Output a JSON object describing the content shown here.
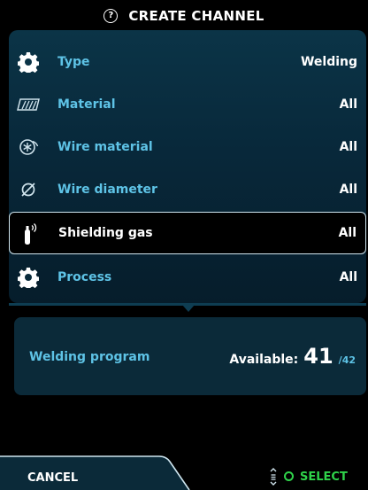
{
  "header": {
    "help_icon": "help-circle-icon",
    "help_glyph": "?",
    "title": "CREATE CHANNEL"
  },
  "list": {
    "items": [
      {
        "icon": "gear-icon",
        "label": "Type",
        "value": "Welding",
        "selected": false
      },
      {
        "icon": "material-icon",
        "label": "Material",
        "value": "All",
        "selected": false
      },
      {
        "icon": "wire-spool-icon",
        "label": "Wire material",
        "value": "All",
        "selected": false
      },
      {
        "icon": "diameter-icon",
        "label": "Wire diameter",
        "value": "All",
        "selected": false
      },
      {
        "icon": "gas-bottle-icon",
        "label": "Shielding gas",
        "value": "All",
        "selected": true
      },
      {
        "icon": "gear-icon",
        "label": "Process",
        "value": "All",
        "selected": false
      }
    ]
  },
  "program": {
    "label": "Welding program",
    "available_label": "Available:",
    "available_count": "41",
    "available_total": "/42"
  },
  "footer": {
    "cancel_label": "CANCEL",
    "select_label": "SELECT"
  },
  "colors": {
    "accent_blue": "#5ec3e6",
    "select_green": "#2fd34a",
    "panel_bg": "#0b3447",
    "background": "#000000"
  }
}
